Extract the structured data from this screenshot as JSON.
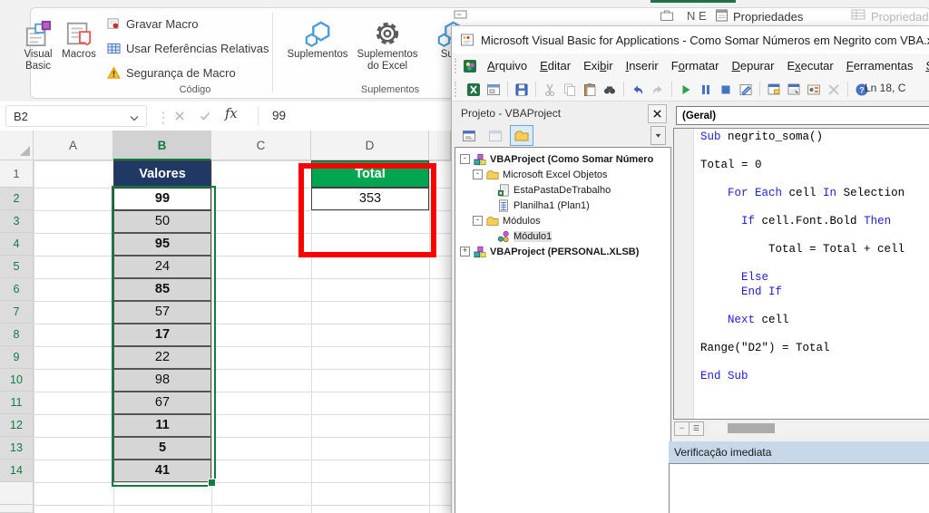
{
  "colors": {
    "excel_green": "#107C41",
    "total_green_fill": "#00A550",
    "valores_navy_fill": "#1F3864",
    "selection_gray_fill": "#D6D6D6",
    "annotation_red": "#FB0000",
    "vba_keyword_blue": "#2222CC",
    "immediate_titlebar": "#C7D8E8"
  },
  "excel": {
    "top_right": {
      "design_letters": "N E",
      "properties_dark": "Propriedades",
      "properties_gray": "Propriedades"
    },
    "ribbon": {
      "code_group": {
        "label": "Código",
        "visual_basic": "Visual Basic",
        "macros": "Macros",
        "record_macro": "Gravar Macro",
        "relative_refs": "Usar Referências Relativas",
        "macro_security": "Segurança de Macro"
      },
      "addins_group": {
        "label": "Suplementos",
        "addins": "Suplementos",
        "excel_addins_line1": "Suplementos",
        "excel_addins_line2": "do Excel",
        "clipped_button": "Sup"
      }
    },
    "formula_bar": {
      "name_box": "B2",
      "fx_label": "fx",
      "value": "99"
    },
    "grid": {
      "columns": [
        {
          "letter": "A",
          "selected": false
        },
        {
          "letter": "B",
          "selected": true
        },
        {
          "letter": "C",
          "selected": false
        },
        {
          "letter": "D",
          "selected": false
        }
      ],
      "rows": [
        {
          "n": "1",
          "selected": false,
          "b": {
            "text": "Valores",
            "bold": true,
            "style": "navy"
          },
          "d": {
            "text": "Total",
            "style": "green"
          }
        },
        {
          "n": "2",
          "selected": true,
          "b": {
            "text": "99",
            "bold": true,
            "style": "active"
          },
          "d": {
            "text": "353",
            "style": "value"
          }
        },
        {
          "n": "3",
          "selected": true,
          "b": {
            "text": "50",
            "bold": false,
            "style": "fill"
          }
        },
        {
          "n": "4",
          "selected": true,
          "b": {
            "text": "95",
            "bold": true,
            "style": "fill"
          }
        },
        {
          "n": "5",
          "selected": true,
          "b": {
            "text": "24",
            "bold": false,
            "style": "fill"
          }
        },
        {
          "n": "6",
          "selected": true,
          "b": {
            "text": "85",
            "bold": true,
            "style": "fill"
          }
        },
        {
          "n": "7",
          "selected": true,
          "b": {
            "text": "57",
            "bold": false,
            "style": "fill"
          }
        },
        {
          "n": "8",
          "selected": true,
          "b": {
            "text": "17",
            "bold": true,
            "style": "fill"
          }
        },
        {
          "n": "9",
          "selected": true,
          "b": {
            "text": "22",
            "bold": false,
            "style": "fill"
          }
        },
        {
          "n": "10",
          "selected": true,
          "b": {
            "text": "98",
            "bold": false,
            "style": "fill"
          }
        },
        {
          "n": "11",
          "selected": true,
          "b": {
            "text": "67",
            "bold": false,
            "style": "fill"
          }
        },
        {
          "n": "12",
          "selected": true,
          "b": {
            "text": "11",
            "bold": true,
            "style": "fill"
          }
        },
        {
          "n": "13",
          "selected": true,
          "b": {
            "text": "5",
            "bold": true,
            "style": "fill"
          }
        },
        {
          "n": "14",
          "selected": true,
          "b": {
            "text": "41",
            "bold": true,
            "style": "fill"
          }
        }
      ]
    }
  },
  "vba": {
    "window_title": "Microsoft Visual Basic for Applications - Como Somar Números em Negrito com VBA.xlsm",
    "menus": [
      {
        "label": "Arquivo",
        "u": 0
      },
      {
        "label": "Editar",
        "u": 0
      },
      {
        "label": "Exibir",
        "u": 3
      },
      {
        "label": "Inserir",
        "u": 0
      },
      {
        "label": "Formatar",
        "u": 1
      },
      {
        "label": "Depurar",
        "u": 0
      },
      {
        "label": "Executar",
        "u": 1
      },
      {
        "label": "Ferramentas",
        "u": 0
      },
      {
        "label": "Suplementos",
        "u": 0
      }
    ],
    "toolbar": [
      "excel-icon",
      "insert-userform-icon",
      "|",
      "save-icon",
      "|",
      "cut-icon",
      "copy-icon",
      "paste-icon",
      "find-icon",
      "|",
      "undo-icon",
      "redo-icon",
      "|",
      "run-icon",
      "break-icon",
      "reset-icon",
      "design-mode-icon",
      "|",
      "project-explorer-icon",
      "properties-window-icon",
      "object-browser-icon",
      "toolbox-icon",
      "|",
      "help-icon"
    ],
    "status_text": "Ln 18, C",
    "project": {
      "title": "Projeto - VBAProject",
      "tree": [
        {
          "label": "VBAProject (Como Somar Número",
          "bold": true,
          "toggle": "-",
          "icon": "project-icon",
          "indent": 0,
          "selected": false
        },
        {
          "label": "Microsoft Excel Objetos",
          "bold": false,
          "toggle": "-",
          "icon": "folder-icon",
          "indent": 1,
          "selected": false
        },
        {
          "label": "EstaPastaDeTrabalho",
          "bold": false,
          "toggle": "",
          "icon": "workbook-icon",
          "indent": 2,
          "selected": false
        },
        {
          "label": "Planilha1 (Plan1)",
          "bold": false,
          "toggle": "",
          "icon": "worksheet-icon",
          "indent": 2,
          "selected": false
        },
        {
          "label": "Módulos",
          "bold": false,
          "toggle": "-",
          "icon": "folder-icon",
          "indent": 1,
          "selected": false
        },
        {
          "label": "Módulo1",
          "bold": false,
          "toggle": "",
          "icon": "module-icon",
          "indent": 2,
          "selected": true
        },
        {
          "label": "VBAProject (PERSONAL.XLSB)",
          "bold": true,
          "toggle": "+",
          "icon": "project-icon",
          "indent": 0,
          "selected": false
        }
      ]
    },
    "code": {
      "header": "(Geral)",
      "lines": [
        [
          {
            "t": "Sub",
            "k": true
          },
          {
            "t": " negrito_soma()"
          }
        ],
        [],
        [
          {
            "t": "Total = 0"
          }
        ],
        [],
        [
          {
            "t": "    "
          },
          {
            "t": "For Each",
            "k": true
          },
          {
            "t": " cell "
          },
          {
            "t": "In",
            "k": true
          },
          {
            "t": " Selection"
          }
        ],
        [],
        [
          {
            "t": "      "
          },
          {
            "t": "If",
            "k": true
          },
          {
            "t": " cell.Font.Bold "
          },
          {
            "t": "Then",
            "k": true
          }
        ],
        [],
        [
          {
            "t": "          Total = Total + cell"
          }
        ],
        [],
        [
          {
            "t": "      "
          },
          {
            "t": "Else",
            "k": true
          }
        ],
        [
          {
            "t": "      "
          },
          {
            "t": "End If",
            "k": true
          }
        ],
        [],
        [
          {
            "t": "    "
          },
          {
            "t": "Next",
            "k": true
          },
          {
            "t": " cell"
          }
        ],
        [],
        [
          {
            "t": "Range(\"D2\") = Total"
          }
        ],
        [],
        [
          {
            "t": "End Sub",
            "k": true
          }
        ]
      ]
    },
    "immediate_title": "Verificação imediata"
  }
}
